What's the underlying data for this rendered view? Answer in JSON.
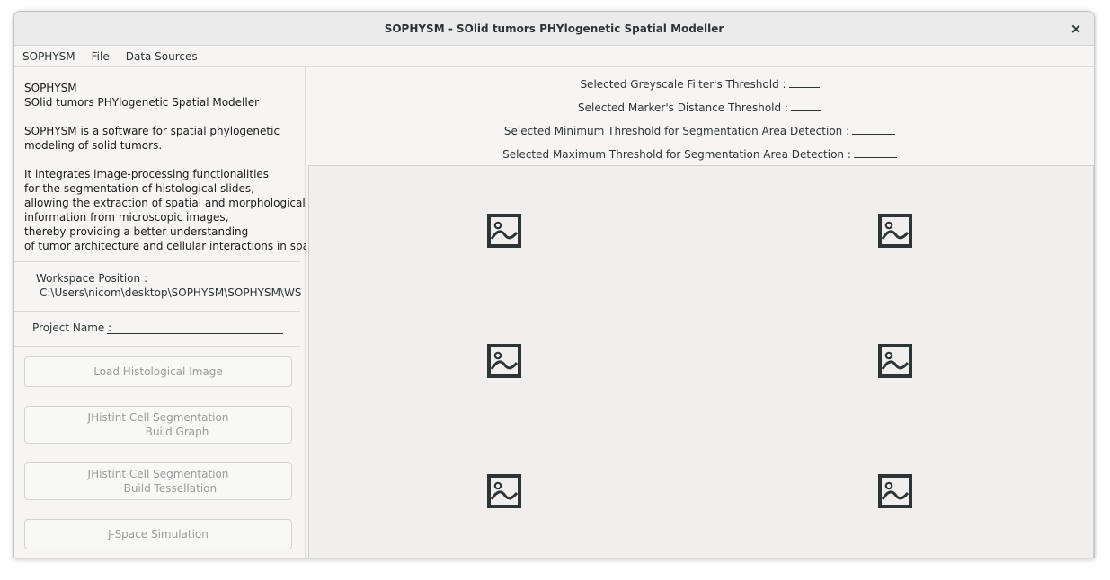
{
  "window": {
    "title": "SOPHYSM - SOlid tumors PHYlogenetic Spatial Modeller",
    "close_icon": "×"
  },
  "menubar": {
    "items": [
      "SOPHYSM",
      "File",
      "Data Sources"
    ]
  },
  "about_text": "SOPHYSM\nSOlid tumors PHYlogenetic Spatial Modeller\n\nSOPHYSM is a software for spatial phylogenetic\nmodeling of solid tumors.\n\nIt integrates image-processing functionalities\nfor the segmentation of histological slides,\nallowing the extraction of spatial and morphological\ninformation from microscopic images,\nthereby providing a better understanding\nof tumor architecture and cellular interactions in space.",
  "workspace": {
    "label": "Workspace Position :",
    "path": "C:\\Users\\nicom\\desktop\\SOPHYSM\\SOPHYSM\\WS"
  },
  "project": {
    "label": "Project Name :"
  },
  "buttons": {
    "load": "Load Histological Image",
    "graph": "JHistint Cell Segmentation\n           Build Graph",
    "tessellation": "JHistint Cell Segmentation\n       Build Tessellation",
    "simulation": "J-Space Simulation"
  },
  "thresholds": {
    "greyscale": "Selected Greyscale Filter's Threshold :",
    "marker": "Selected Marker's Distance Threshold :",
    "min_area": "Selected Minimum Threshold for Segmentation Area Detection :",
    "max_area": "Selected Maximum Threshold for Segmentation Area Detection :"
  },
  "image_placeholders": [
    "image-missing-icon",
    "image-missing-icon",
    "image-missing-icon",
    "image-missing-icon",
    "image-missing-icon",
    "image-missing-icon"
  ]
}
